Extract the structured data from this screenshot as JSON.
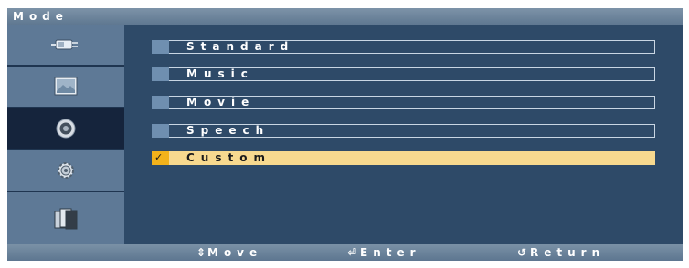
{
  "window": {
    "title": "Mode"
  },
  "sidebar": {
    "items": [
      {
        "icon": "input-plug-icon",
        "active": false
      },
      {
        "icon": "picture-icon",
        "active": false
      },
      {
        "icon": "sound-speaker-icon",
        "active": true
      },
      {
        "icon": "setup-gear-icon",
        "active": false
      },
      {
        "icon": "multi-window-icon",
        "active": false
      }
    ]
  },
  "menu": {
    "options": [
      {
        "label": "Standard",
        "selected": false
      },
      {
        "label": "Music",
        "selected": false
      },
      {
        "label": "Movie",
        "selected": false
      },
      {
        "label": "Speech",
        "selected": false
      },
      {
        "label": "Custom",
        "selected": true,
        "check": "✓"
      }
    ]
  },
  "footer": {
    "move_icon": "⇕",
    "move": "Move",
    "enter_icon": "⏎",
    "enter": "Enter",
    "return_icon": "↺",
    "return": "Return"
  },
  "colors": {
    "background": "#2e4a68",
    "sidebar": "#5e7996",
    "sidebar_active": "#15243c",
    "selection": "#f7d98f",
    "selection_mark": "#f2b21b"
  }
}
